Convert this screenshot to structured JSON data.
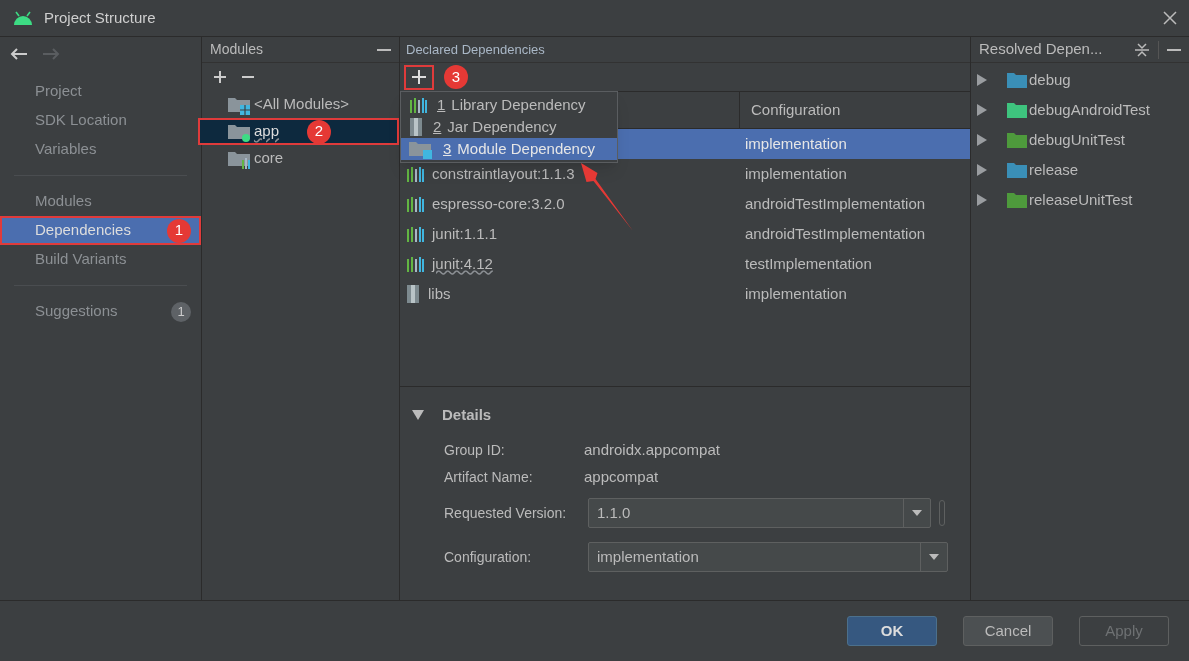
{
  "window": {
    "title": "Project Structure"
  },
  "sidebar": {
    "groups": [
      [
        {
          "label": "Project",
          "selected": false
        },
        {
          "label": "SDK Location",
          "selected": false
        },
        {
          "label": "Variables",
          "selected": false
        }
      ],
      [
        {
          "label": "Modules",
          "selected": false
        },
        {
          "label": "Dependencies",
          "selected": true,
          "marker": "1"
        },
        {
          "label": "Build Variants",
          "selected": false
        }
      ],
      [
        {
          "label": "Suggestions",
          "selected": false,
          "count": "1"
        }
      ]
    ]
  },
  "modules": {
    "title": "Modules",
    "items": [
      {
        "label": "<All Modules>",
        "kind": "all",
        "selected": false,
        "warning": false
      },
      {
        "label": "app",
        "kind": "app",
        "selected": true,
        "warning": true,
        "marker": "2"
      },
      {
        "label": "core",
        "kind": "library",
        "selected": false,
        "warning": false
      }
    ]
  },
  "declared": {
    "title": "Declared Dependencies",
    "add_marker": "3",
    "menu": [
      {
        "number": "1",
        "label": "Library Dependency",
        "kind": "library",
        "selected": false
      },
      {
        "number": "2",
        "label": "Jar Dependency",
        "kind": "jar",
        "selected": false
      },
      {
        "number": "3",
        "label": "Module Dependency",
        "kind": "module",
        "selected": true
      }
    ],
    "columns": {
      "column_2": "Configuration"
    },
    "rows": [
      {
        "configuration": "implementation",
        "selected": true
      },
      {
        "name": "constraintlayout:1.1.3",
        "kind": "library",
        "configuration": "implementation",
        "selected": false,
        "warning": false
      },
      {
        "name": "espresso-core:3.2.0",
        "kind": "library",
        "configuration": "androidTestImplementation",
        "selected": false,
        "warning": false
      },
      {
        "name": "junit:1.1.1",
        "kind": "library",
        "configuration": "androidTestImplementation",
        "selected": false,
        "warning": false
      },
      {
        "name": "junit:4.12",
        "kind": "library",
        "configuration": "testImplementation",
        "selected": false,
        "warning": true
      },
      {
        "name": "libs",
        "kind": "jar",
        "configuration": "implementation",
        "selected": false,
        "warning": false
      }
    ],
    "details": {
      "title": "Details",
      "expanded": true,
      "group_id": {
        "label": "Group ID:",
        "value": "androidx.appcompat"
      },
      "artifact": {
        "label": "Artifact Name:",
        "value": "appcompat"
      },
      "version": {
        "label": "Requested Version:",
        "value": "1.1.0"
      },
      "configuration": {
        "label": "Configuration:",
        "value": "implementation"
      }
    }
  },
  "resolved": {
    "title": "Resolved Depen...",
    "items": [
      {
        "label": "debug",
        "color": "#3a8fb7"
      },
      {
        "label": "debugAndroidTest",
        "color": "#3ec47e"
      },
      {
        "label": "debugUnitTest",
        "color": "#4e9a3c"
      },
      {
        "label": "release",
        "color": "#3a8fb7"
      },
      {
        "label": "releaseUnitTest",
        "color": "#4e9a3c"
      }
    ]
  },
  "buttons": [
    {
      "label": "OK",
      "kind": "primary",
      "disabled": false
    },
    {
      "label": "Cancel",
      "kind": "normal",
      "disabled": false
    },
    {
      "label": "Apply",
      "kind": "normal",
      "disabled": true
    }
  ]
}
